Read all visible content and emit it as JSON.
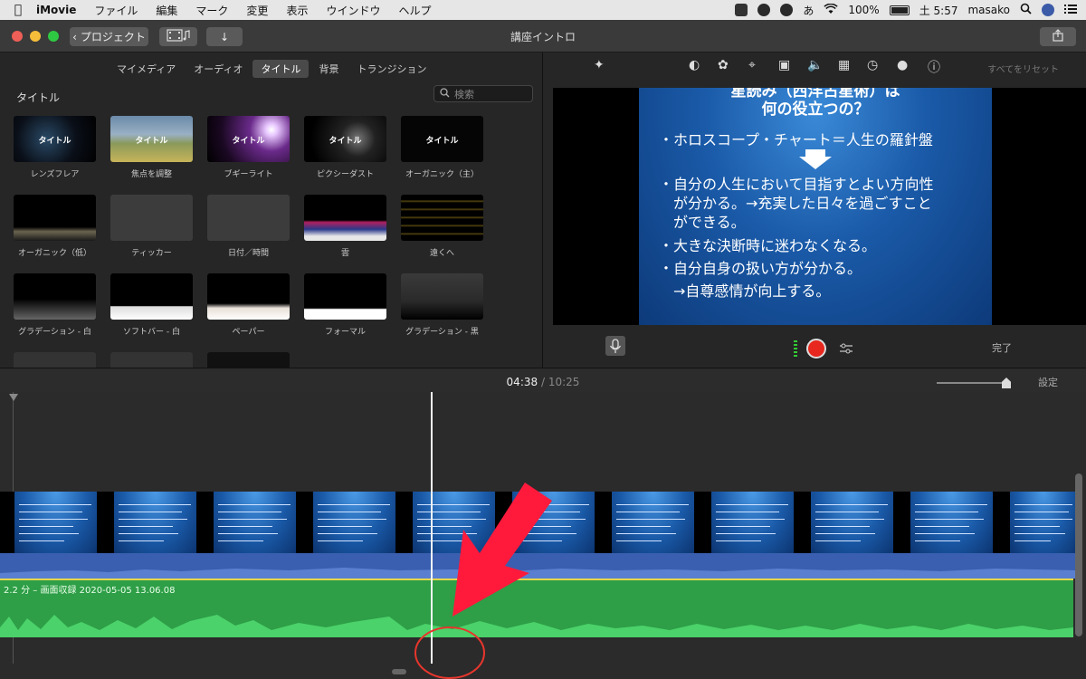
{
  "menubar": {
    "app": "iMovie",
    "items": [
      "ファイル",
      "編集",
      "マーク",
      "変更",
      "表示",
      "ウインドウ",
      "ヘルプ"
    ],
    "battery": "100%",
    "ime": "あ",
    "clock": "土 5:57",
    "user": "masako"
  },
  "toolbar": {
    "back_label": "プロジェクト",
    "window_title": "講座イントロ"
  },
  "browser": {
    "tabs": [
      "マイメディア",
      "オーディオ",
      "タイトル",
      "背景",
      "トランジション"
    ],
    "active_tab": "タイトル",
    "section_title": "タイトル",
    "search_placeholder": "検索",
    "titles": [
      {
        "name": "レンズフレア",
        "thumb_text": "タイトル"
      },
      {
        "name": "焦点を調整",
        "thumb_text": "タイトル"
      },
      {
        "name": "ブギーライト",
        "thumb_text": "タイトル"
      },
      {
        "name": "ピクシーダスト",
        "thumb_text": "タイトル"
      },
      {
        "name": "オーガニック（主）",
        "thumb_text": "タイトル"
      },
      {
        "name": "オーガニック（低）",
        "thumb_text": ""
      },
      {
        "name": "ティッカー",
        "thumb_text": ""
      },
      {
        "name": "日付／時間",
        "thumb_text": ""
      },
      {
        "name": "雲",
        "thumb_text": ""
      },
      {
        "name": "遠くへ",
        "thumb_text": ""
      },
      {
        "name": "グラデーション - 白",
        "thumb_text": ""
      },
      {
        "name": "ソフトバー - 白",
        "thumb_text": ""
      },
      {
        "name": "ペーパー",
        "thumb_text": ""
      },
      {
        "name": "フォーマル",
        "thumb_text": ""
      },
      {
        "name": "グラデーション - 黒",
        "thumb_text": ""
      }
    ]
  },
  "inspector": {
    "reset_label": "すべてをリセット"
  },
  "viewer": {
    "slide_title_line1": "星読み（西洋占星術）は",
    "slide_title_line2": "何の役立つの？",
    "bullet1": "・ホロスコープ・チャート＝人生の羅針盤",
    "bullet2a": "・自分の人生において目指すとよい方向性",
    "bullet2b": "　が分かる。→充実した日々を過ごすこと",
    "bullet2c": "　ができる。",
    "bullet3": "・大きな決断時に迷わなくなる。",
    "bullet4": "・自分自身の扱い方が分かる。",
    "bullet5": "　→自尊感情が向上する。",
    "done_label": "完了"
  },
  "timeline": {
    "current_time": "04:38",
    "separator": "/",
    "total_time": "10:25",
    "settings_label": "設定",
    "clip_label": "2.2 分 – 画面収録 2020-05-05 13.06.08"
  },
  "annotation": {
    "arrow_color": "#ff1a3c",
    "circle_color": "#e8362c"
  }
}
